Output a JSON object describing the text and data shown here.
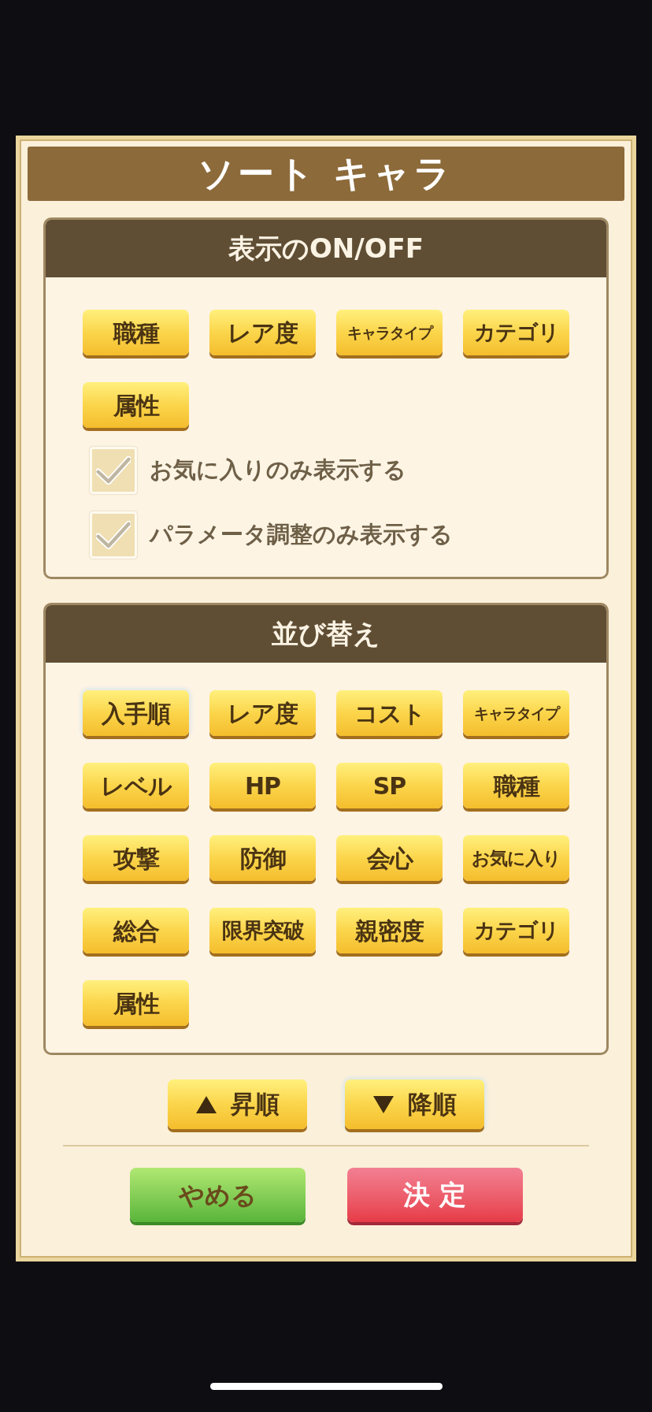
{
  "dialog": {
    "title": "ソート キャラ"
  },
  "display_section": {
    "heading": "表示のON/OFF",
    "buttons": [
      "職種",
      "レア度",
      "キャラタイプ",
      "カテゴリ",
      "属性"
    ],
    "checkboxes": [
      {
        "label": "お気に入りのみ表示する",
        "checked": false
      },
      {
        "label": "パラメータ調整のみ表示する",
        "checked": false
      }
    ]
  },
  "sort_section": {
    "heading": "並び替え",
    "options": [
      {
        "label": "入手順",
        "selected": true
      },
      {
        "label": "レア度",
        "selected": false
      },
      {
        "label": "コスト",
        "selected": false
      },
      {
        "label": "キャラタイプ",
        "selected": false
      },
      {
        "label": "レベル",
        "selected": false
      },
      {
        "label": "HP",
        "selected": false
      },
      {
        "label": "SP",
        "selected": false
      },
      {
        "label": "職種",
        "selected": false
      },
      {
        "label": "攻撃",
        "selected": false
      },
      {
        "label": "防御",
        "selected": false
      },
      {
        "label": "会心",
        "selected": false
      },
      {
        "label": "お気に入り",
        "selected": false
      },
      {
        "label": "総合",
        "selected": false
      },
      {
        "label": "限界突破",
        "selected": false
      },
      {
        "label": "親密度",
        "selected": false
      },
      {
        "label": "カテゴリ",
        "selected": false
      },
      {
        "label": "属性",
        "selected": false
      }
    ]
  },
  "order_buttons": [
    {
      "kind": "ascending",
      "label": "昇順",
      "selected": false
    },
    {
      "kind": "descending",
      "label": "降順",
      "selected": true
    }
  ],
  "actions": [
    {
      "kind": "cancel",
      "label": "やめる"
    },
    {
      "kind": "confirm",
      "label": "決 定"
    }
  ]
}
